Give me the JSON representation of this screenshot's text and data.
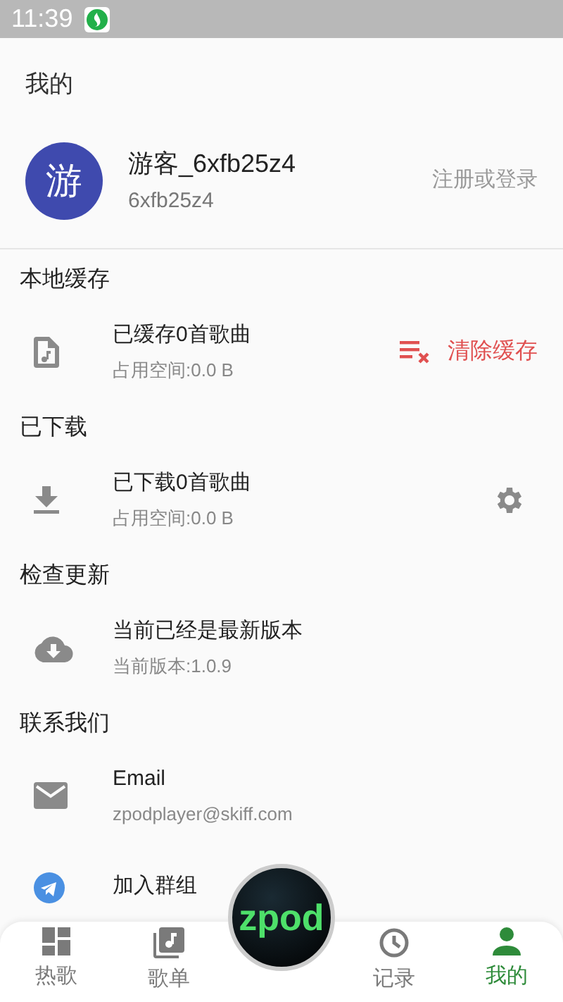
{
  "status_bar": {
    "time": "11:39"
  },
  "header": {
    "title": "我的"
  },
  "profile": {
    "avatar": "游",
    "name": "游客_6xfb25z4",
    "id": "6xfb25z4",
    "login": "注册或登录"
  },
  "sections": [
    {
      "title": "本地缓存",
      "items": [
        {
          "kind": "music-file",
          "title": "已缓存0首歌曲",
          "subtitle": "占用空间:0.0 B",
          "action": {
            "kind": "clear",
            "label": "清除缓存"
          }
        }
      ]
    },
    {
      "title": "已下载",
      "items": [
        {
          "kind": "download",
          "title": "已下载0首歌曲",
          "subtitle": "占用空间:0.0 B",
          "action": {
            "kind": "settings"
          }
        }
      ]
    },
    {
      "title": "检查更新",
      "items": [
        {
          "kind": "cloud",
          "title": "当前已经是最新版本",
          "subtitle": "当前版本:1.0.9"
        }
      ]
    },
    {
      "title": "联系我们",
      "items": [
        {
          "kind": "mail",
          "title": "Email",
          "subtitle": "zpodplayer@skiff.com"
        },
        {
          "kind": "telegram",
          "title": "加入群组"
        }
      ]
    }
  ],
  "player_button": {
    "label": "zpod"
  },
  "nav": [
    {
      "label": "热歌",
      "selected": false
    },
    {
      "label": "歌单",
      "selected": false
    },
    {
      "label": "记录",
      "selected": false
    },
    {
      "label": "我的",
      "selected": true
    }
  ]
}
